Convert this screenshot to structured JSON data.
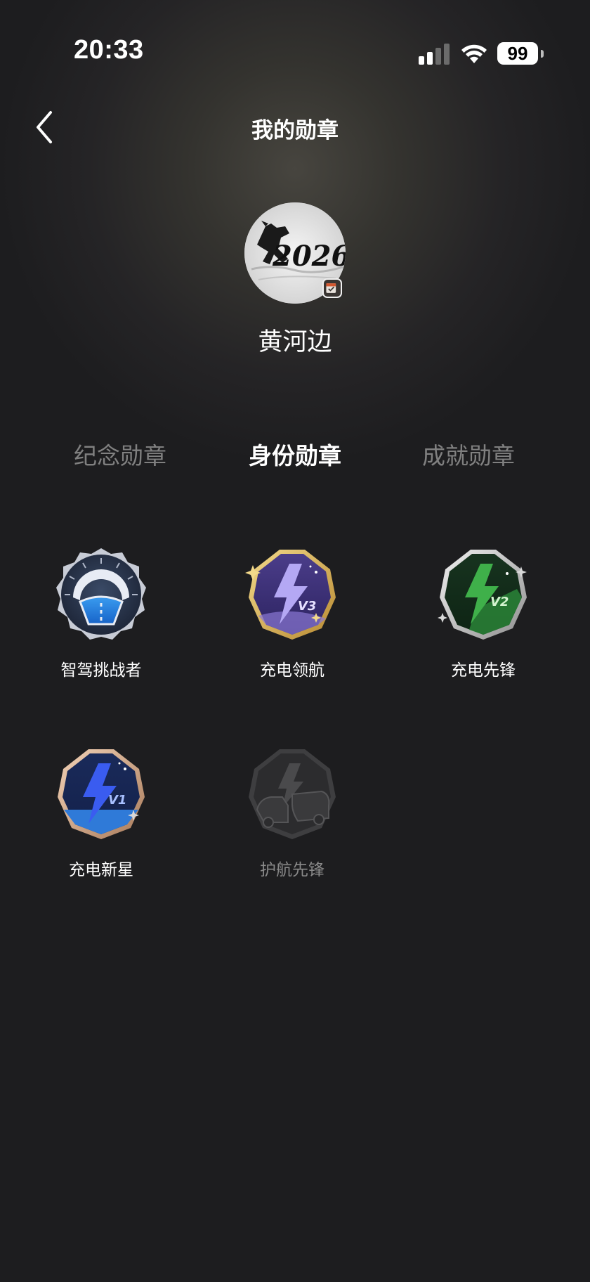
{
  "status_bar": {
    "time": "20:33",
    "battery": "99",
    "signal_icon": "cellular-signal-icon",
    "wifi_icon": "wifi-icon"
  },
  "header": {
    "title": "我的勋章",
    "back_icon": "chevron-left-icon"
  },
  "profile": {
    "avatar_text": "2026",
    "username": "黄河边"
  },
  "tabs": [
    {
      "label": "纪念勋章",
      "active": false
    },
    {
      "label": "身份勋章",
      "active": true
    },
    {
      "label": "成就勋章",
      "active": false
    }
  ],
  "badges": [
    {
      "label": "智驾挑战者",
      "icon": "steering-road-badge-icon",
      "unlocked": true
    },
    {
      "label": "充电领航",
      "icon": "lightning-v3-badge-icon",
      "level": "V3",
      "unlocked": true
    },
    {
      "label": "充电先锋",
      "icon": "lightning-v2-badge-icon",
      "level": "V2",
      "unlocked": true
    },
    {
      "label": "充电新星",
      "icon": "lightning-v1-badge-icon",
      "level": "V1",
      "unlocked": true
    },
    {
      "label": "护航先锋",
      "icon": "lightning-car-badge-icon",
      "unlocked": false
    }
  ],
  "colors": {
    "background": "#1d1d1f",
    "active_tab": "#ffffff",
    "inactive_tab": "#808080",
    "locked_label": "#8a8a8a"
  }
}
